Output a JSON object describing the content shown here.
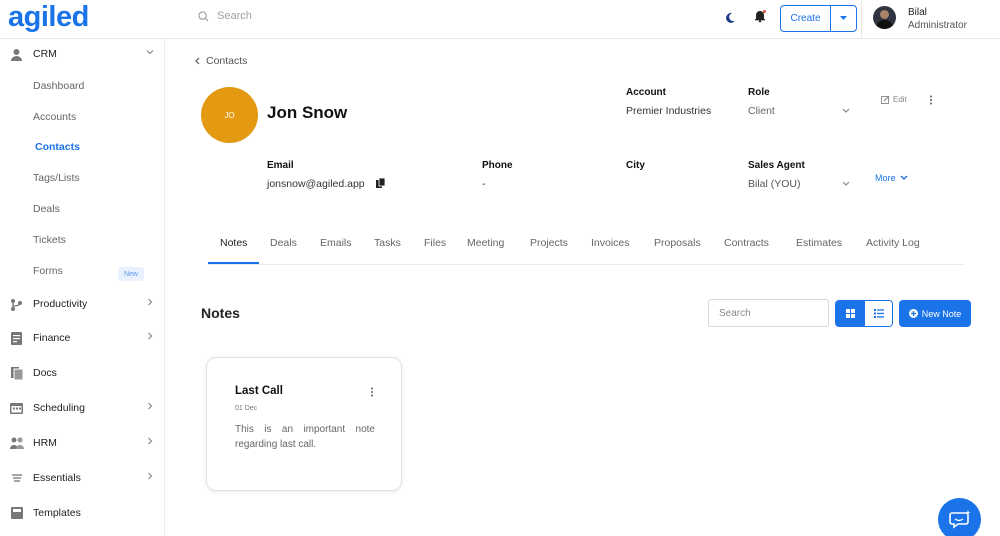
{
  "app": {
    "logo": "agiled"
  },
  "header": {
    "search_placeholder": "Search",
    "create_label": "Create",
    "user_name": "Bilal",
    "user_role": "Administrator"
  },
  "sidebar": {
    "crm": "CRM",
    "sub_items": [
      "Dashboard",
      "Accounts",
      "Contacts",
      "Tags/Lists",
      "Deals",
      "Tickets",
      "Forms"
    ],
    "new_badge": "New",
    "items": [
      "Productivity",
      "Finance",
      "Docs",
      "Scheduling",
      "HRM",
      "Essentials",
      "Templates"
    ]
  },
  "breadcrumb": "Contacts",
  "contact": {
    "initials": "JO",
    "name": "Jon Snow",
    "account_label": "Account",
    "account_value": "Premier Industries",
    "role_label": "Role",
    "role_value": "Client",
    "email_label": "Email",
    "email_value": "jonsnow@agiled.app",
    "phone_label": "Phone",
    "phone_value": "-",
    "city_label": "City",
    "city_value": "",
    "agent_label": "Sales Agent",
    "agent_value": "Bilal (YOU)",
    "edit_label": "Edit",
    "more_label": "More"
  },
  "tabs": [
    "Notes",
    "Deals",
    "Emails",
    "Tasks",
    "Files",
    "Meeting",
    "Projects",
    "Invoices",
    "Proposals",
    "Contracts",
    "Estimates",
    "Activity Log"
  ],
  "notes": {
    "title": "Notes",
    "search_placeholder": "Search",
    "new_note_label": "New Note",
    "cards": [
      {
        "title": "Last Call",
        "date": "01 Dec",
        "body": "This is an important note regarding last call."
      }
    ]
  },
  "colors": {
    "brand": "#1a73e8",
    "avatar": "#e39a12"
  }
}
